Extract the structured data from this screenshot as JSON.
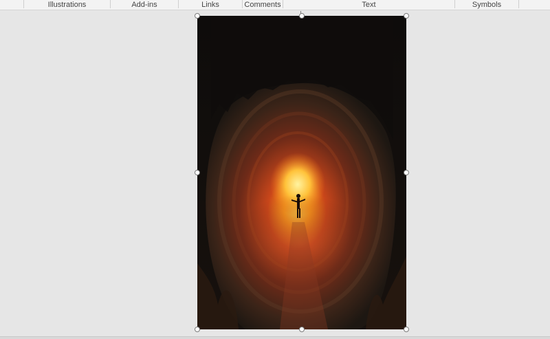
{
  "ribbon": {
    "groups": [
      {
        "label": "Illustrations"
      },
      {
        "label": "Add-ins"
      },
      {
        "label": "Links"
      },
      {
        "label": "Comments"
      },
      {
        "label": "Text"
      },
      {
        "label": "Symbols"
      }
    ]
  },
  "document": {
    "picture": {
      "selected": true
    }
  },
  "colors": {
    "ribbon_bg": "#f3f3f3",
    "workspace_bg": "#e6e6e6",
    "handle_fill": "#ffffff",
    "handle_border": "#7a7a7a"
  }
}
